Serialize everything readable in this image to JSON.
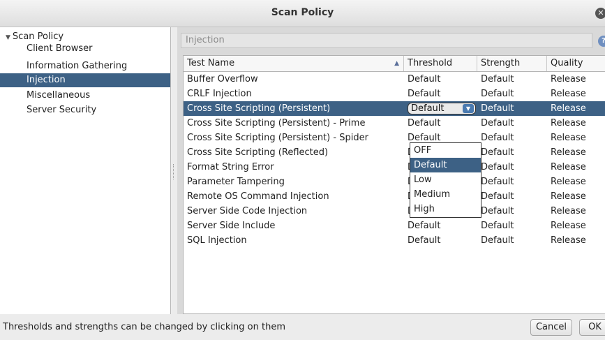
{
  "window": {
    "title": "Scan Policy",
    "close_glyph": "✕"
  },
  "tree": {
    "root_label": "Scan Policy",
    "root_arrow": "▼",
    "items": [
      {
        "label": "Client Browser"
      },
      {
        "label": "Information Gathering"
      },
      {
        "label": "Injection",
        "selected": true
      },
      {
        "label": "Miscellaneous"
      },
      {
        "label": "Server Security"
      }
    ]
  },
  "panel": {
    "heading": "Injection",
    "help_glyph": "?"
  },
  "table": {
    "columns": [
      "Test Name",
      "Threshold",
      "Strength",
      "Quality"
    ],
    "sort_glyph": "▲",
    "rows": [
      {
        "name": "Buffer Overflow",
        "threshold": "Default",
        "strength": "Default",
        "quality": "Release"
      },
      {
        "name": "CRLF Injection",
        "threshold": "Default",
        "strength": "Default",
        "quality": "Release"
      },
      {
        "name": "Cross Site Scripting (Persistent)",
        "threshold": "Default",
        "strength": "Default",
        "quality": "Release"
      },
      {
        "name": "Cross Site Scripting (Persistent) - Prime",
        "threshold": "Default",
        "strength": "Default",
        "quality": "Release"
      },
      {
        "name": "Cross Site Scripting (Persistent) - Spider",
        "threshold": "Default",
        "strength": "Default",
        "quality": "Release"
      },
      {
        "name": "Cross Site Scripting (Reflected)",
        "threshold": "Default",
        "strength": "Default",
        "quality": "Release"
      },
      {
        "name": "Format String Error",
        "threshold": "Default",
        "strength": "Default",
        "quality": "Release"
      },
      {
        "name": "Parameter Tampering",
        "threshold": "Default",
        "strength": "Default",
        "quality": "Release"
      },
      {
        "name": "Remote OS Command Injection",
        "threshold": "Default",
        "strength": "Default",
        "quality": "Release"
      },
      {
        "name": "Server Side Code Injection",
        "threshold": "Default",
        "strength": "Default",
        "quality": "Release"
      },
      {
        "name": "Server Side Include",
        "threshold": "Default",
        "strength": "Default",
        "quality": "Release"
      },
      {
        "name": "SQL Injection",
        "threshold": "Default",
        "strength": "Default",
        "quality": "Release"
      }
    ],
    "selected_row": 2,
    "combo": {
      "value": "Default",
      "arrow_glyph": "▼"
    }
  },
  "dropdown": {
    "options": [
      "OFF",
      "Default",
      "Low",
      "Medium",
      "High"
    ],
    "selected": 1
  },
  "status": {
    "text": "Thresholds and strengths can be changed by clicking on them",
    "cancel_label": "Cancel",
    "ok_label": "OK"
  },
  "colors": {
    "selection": "#3d6185",
    "accent": "#4a7ab0"
  }
}
